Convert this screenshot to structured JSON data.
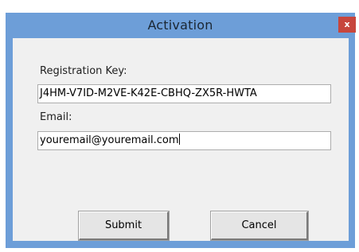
{
  "window": {
    "title": "Activation",
    "close_label": "x",
    "colors": {
      "titlebar": "#6d9ed8",
      "close_button": "#c7463d",
      "client_bg": "#f0f0f0"
    }
  },
  "form": {
    "registration_key_label": "Registration Key:",
    "registration_key_value": "J4HM-V7ID-M2VE-K42E-CBHQ-ZX5R-HWTA",
    "email_label": "Email:",
    "email_value": "youremail@youremail.com"
  },
  "buttons": {
    "submit_label": "Submit",
    "cancel_label": "Cancel"
  }
}
